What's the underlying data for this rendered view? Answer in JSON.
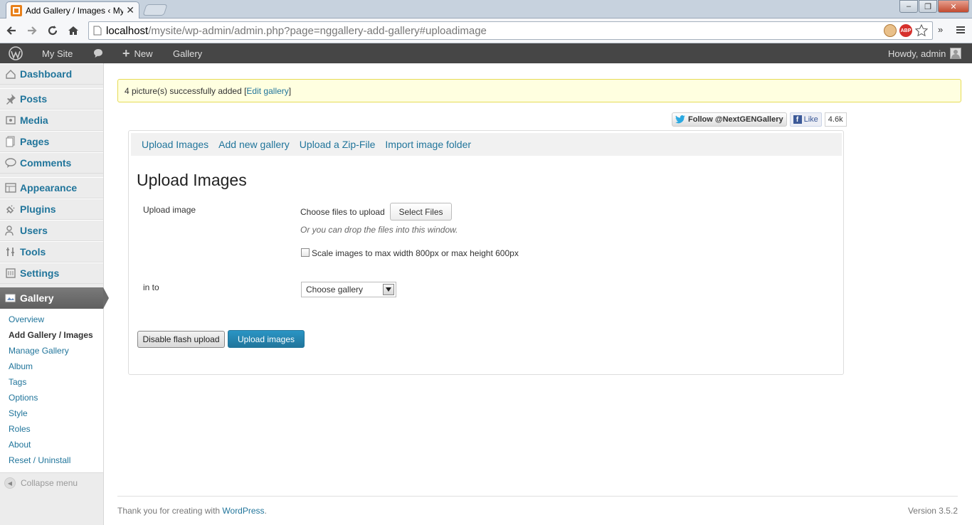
{
  "browser": {
    "tab_title": "Add Gallery / Images ‹ My",
    "url_host": "localhost",
    "url_path": "/mysite/wp-admin/admin.php?page=nggallery-add-gallery#uploadimage",
    "window_minimize": "–",
    "window_maximize": "❐",
    "window_close": "✕",
    "more_label": "»"
  },
  "adminbar": {
    "site_name": "My Site",
    "new_label": "New",
    "gallery_label": "Gallery",
    "howdy": "Howdy, admin"
  },
  "sidebar": {
    "items": [
      {
        "label": "Dashboard",
        "icon": "dashboard-icon"
      },
      {
        "label": "Posts",
        "icon": "pin-icon"
      },
      {
        "label": "Media",
        "icon": "media-icon"
      },
      {
        "label": "Pages",
        "icon": "pages-icon"
      },
      {
        "label": "Comments",
        "icon": "comment-icon"
      },
      {
        "label": "Appearance",
        "icon": "appearance-icon"
      },
      {
        "label": "Plugins",
        "icon": "plugin-icon"
      },
      {
        "label": "Users",
        "icon": "users-icon"
      },
      {
        "label": "Tools",
        "icon": "tools-icon"
      },
      {
        "label": "Settings",
        "icon": "settings-icon"
      }
    ],
    "gallery": {
      "label": "Gallery"
    },
    "submenu": [
      "Overview",
      "Add Gallery / Images",
      "Manage Gallery",
      "Album",
      "Tags",
      "Options",
      "Style",
      "Roles",
      "About",
      "Reset / Uninstall"
    ],
    "collapse_label": "Collapse menu"
  },
  "notice": {
    "text": "4 picture(s) successfully added [",
    "link": "Edit gallery",
    "suffix": "]"
  },
  "social": {
    "twitter": "Follow @NextGENGallery",
    "fb_like": "Like",
    "fb_count": "4.6k"
  },
  "tabs": [
    "Upload Images",
    "Add new gallery",
    "Upload a Zip-File",
    "Import image folder"
  ],
  "form": {
    "heading": "Upload Images",
    "upload_label": "Upload image",
    "choose_text": "Choose files to upload",
    "select_files": "Select Files",
    "drop_hint": "Or you can drop the files into this window.",
    "scale_label": "Scale images to max width 800px or max height 600px",
    "scale_checked": false,
    "into_label": "in to",
    "gallery_select": "Choose gallery",
    "disable_flash": "Disable flash upload",
    "upload_button": "Upload images"
  },
  "footer": {
    "thanks": "Thank you for creating with ",
    "wp_link": "WordPress",
    "period": ".",
    "version": "Version 3.5.2"
  },
  "colors": {
    "link": "#21759b",
    "adminbar": "#464646",
    "notice_bg": "#ffffe0",
    "primary_button": "#21759b"
  }
}
